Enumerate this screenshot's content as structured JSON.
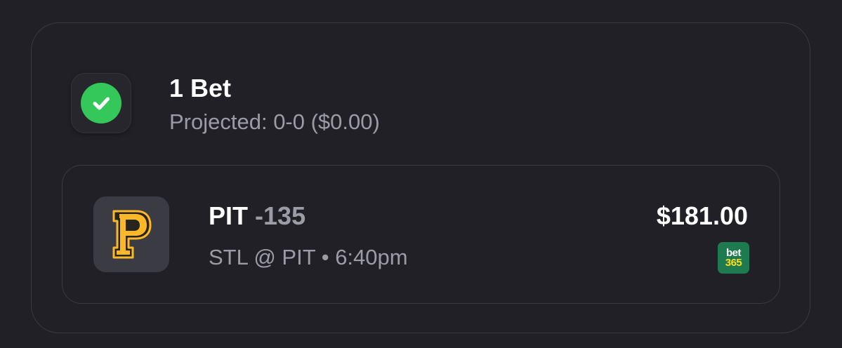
{
  "summary": {
    "title": "1 Bet",
    "projected": "Projected: 0-0 ($0.00)",
    "status_icon": "check-icon",
    "status_color": "#34c759"
  },
  "bet": {
    "team": "PIT",
    "odds": "-135",
    "game": "STL @ PIT",
    "separator": "•",
    "time": "6:40pm",
    "amount": "$181.00",
    "team_logo": {
      "letter": "P",
      "colors": [
        "#fdb827",
        "#27251f"
      ]
    },
    "book": {
      "label_top": "bet",
      "label_bottom": "365",
      "bg_color": "#1e7a4f",
      "accent_color": "#ffdf1b"
    }
  }
}
